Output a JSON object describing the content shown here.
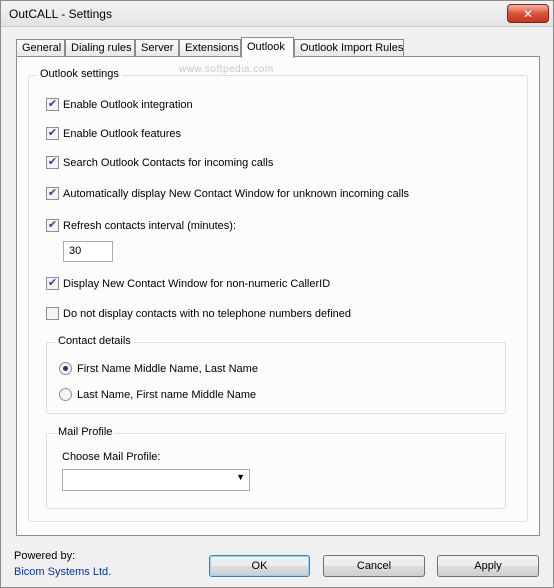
{
  "window": {
    "title": "OutCALL - Settings",
    "close_glyph": "✕"
  },
  "tabs": [
    {
      "label": "General",
      "active": false
    },
    {
      "label": "Dialing rules",
      "active": false
    },
    {
      "label": "Server",
      "active": false
    },
    {
      "label": "Extensions",
      "active": false
    },
    {
      "label": "Outlook",
      "active": true
    },
    {
      "label": "Outlook Import Rules",
      "active": false
    }
  ],
  "watermark": "www.softpedia.com",
  "outlook_settings": {
    "group_label": "Outlook settings",
    "options": [
      {
        "label": "Enable Outlook integration",
        "checked": true
      },
      {
        "label": "Enable Outlook features",
        "checked": true
      },
      {
        "label": "Search Outlook Contacts for incoming calls",
        "checked": true
      },
      {
        "label": "Automatically display New Contact Window for unknown incoming calls",
        "checked": true
      },
      {
        "label": "Refresh contacts interval (minutes):",
        "checked": true
      },
      {
        "label": "Display New Contact Window for non-numeric CallerID",
        "checked": true
      },
      {
        "label": "Do not display contacts with no telephone numbers defined",
        "checked": false
      }
    ],
    "refresh_interval_value": "30",
    "check_glyph": "✔"
  },
  "contact_details": {
    "group_label": "Contact details",
    "options": [
      {
        "label": "First Name Middle Name, Last Name",
        "selected": true
      },
      {
        "label": "Last Name, First name Middle Name",
        "selected": false
      }
    ]
  },
  "mail_profile": {
    "group_label": "Mail Profile",
    "choose_label": "Choose Mail Profile:",
    "selected_value": "",
    "arrow_glyph": "▼"
  },
  "footer": {
    "powered_by": "Powered by:",
    "company_link": "Bicom Systems Ltd.",
    "ok_label": "OK",
    "cancel_label": "Cancel",
    "apply_label": "Apply"
  }
}
